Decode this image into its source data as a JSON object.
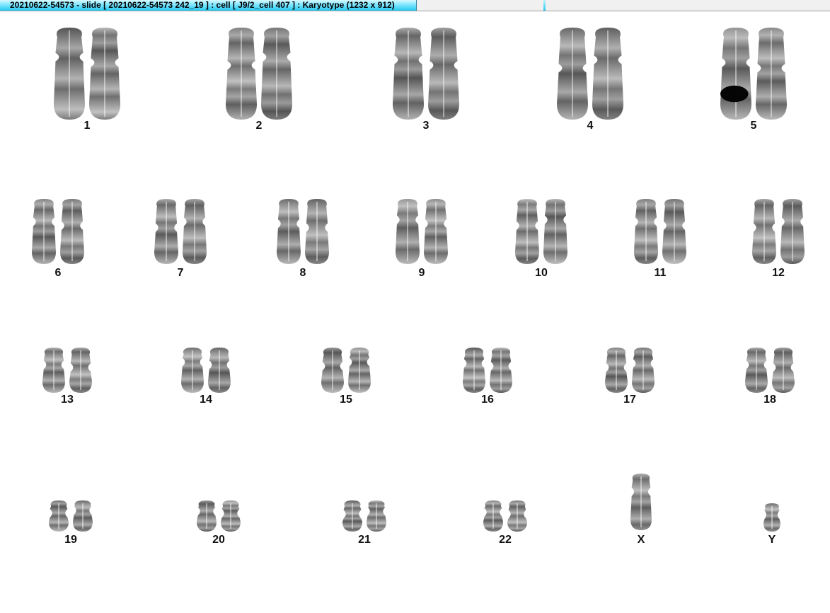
{
  "window": {
    "title": "20210622-54573 - slide [ 20210622-54573 242_19 ] : cell [ J9/2_cell 407 ] : Karyotype  (1232 x 912)"
  },
  "karyotype": {
    "rows": [
      {
        "slots": [
          {
            "label": "1",
            "count": 2
          },
          {
            "label": "2",
            "count": 2
          },
          {
            "label": "3",
            "count": 2
          },
          {
            "label": "4",
            "count": 2
          },
          {
            "label": "5",
            "count": 2
          }
        ]
      },
      {
        "slots": [
          {
            "label": "6",
            "count": 2
          },
          {
            "label": "7",
            "count": 2
          },
          {
            "label": "8",
            "count": 2
          },
          {
            "label": "9",
            "count": 2
          },
          {
            "label": "10",
            "count": 2
          },
          {
            "label": "11",
            "count": 2
          },
          {
            "label": "12",
            "count": 2
          }
        ]
      },
      {
        "slots": [
          {
            "label": "13",
            "count": 2
          },
          {
            "label": "14",
            "count": 2
          },
          {
            "label": "15",
            "count": 2
          },
          {
            "label": "16",
            "count": 2
          },
          {
            "label": "17",
            "count": 2
          },
          {
            "label": "18",
            "count": 2
          }
        ]
      },
      {
        "slots": [
          {
            "label": "19",
            "count": 2
          },
          {
            "label": "20",
            "count": 2
          },
          {
            "label": "21",
            "count": 2
          },
          {
            "label": "22",
            "count": 2
          },
          {
            "label": "X",
            "count": 1
          },
          {
            "label": "Y",
            "count": 1
          }
        ]
      }
    ]
  },
  "colors": {
    "title_gradient_top": "#d6f8ff",
    "title_gradient_bottom": "#22c8f0",
    "chromosome_light": "#c8c8c8",
    "chromosome_dark": "#3a3a3a",
    "label": "#111111"
  }
}
